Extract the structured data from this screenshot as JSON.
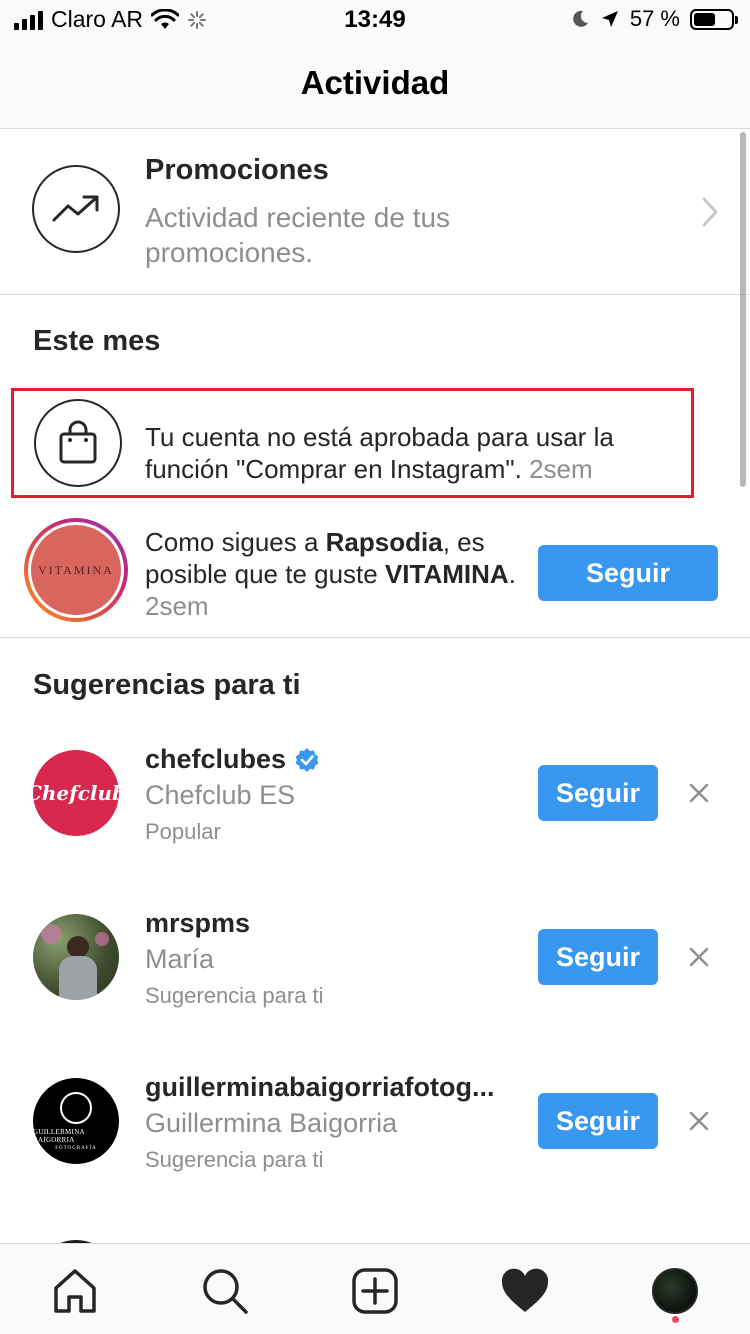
{
  "status_bar": {
    "carrier": "Claro AR",
    "time": "13:49",
    "battery": "57 %",
    "battery_level": 0.57
  },
  "header": {
    "title": "Actividad"
  },
  "promotions": {
    "title": "Promociones",
    "subtitle": "Actividad reciente de tus promociones."
  },
  "section_month": {
    "title": "Este mes"
  },
  "notice": {
    "text": "Tu cuenta no está aprobada para usar la función \"Comprar en Instagram\".",
    "time": "2sem"
  },
  "suggestion": {
    "pre": "Como sigues a ",
    "followed": "Rapsodia",
    "mid": ", es posible que te guste ",
    "suggested": "VITAMINA",
    "post": ".",
    "time": "2sem",
    "avatar_text": "VITAMINA",
    "button": "Seguir"
  },
  "section_suggestions": {
    "title": "Sugerencias para ti"
  },
  "accounts": [
    {
      "username": "chefclubes",
      "verified": true,
      "name": "Chefclub ES",
      "reason": "Popular",
      "avatar_text": "Chefclub",
      "button": "Seguir"
    },
    {
      "username": "mrspms",
      "verified": false,
      "name": "María",
      "reason": "Sugerencia para ti",
      "button": "Seguir"
    },
    {
      "username": "guillerminabaigorriafotog...",
      "verified": false,
      "name": "Guillermina Baigorria",
      "reason": "Sugerencia para ti",
      "avatar_text": "GUILLERMINA BAIGORRIA",
      "avatar_subtext": "FOTOGRAFÍA",
      "button": "Seguir"
    }
  ],
  "tabs": [
    "home-icon",
    "search-icon",
    "new-post-icon",
    "activity-heart-icon",
    "profile-avatar"
  ],
  "colors": {
    "accent": "#3897f0",
    "highlight_border": "#e0202d",
    "notification_dot": "#ed4956"
  }
}
